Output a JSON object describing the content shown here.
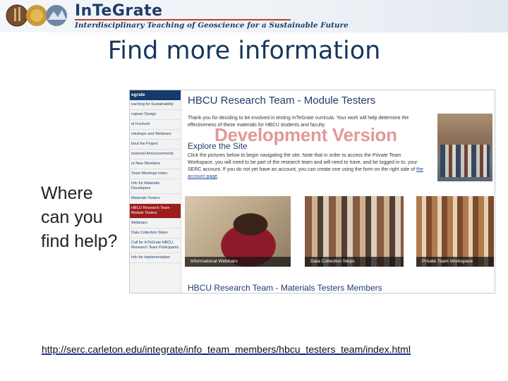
{
  "header": {
    "brand": "InTeGrate",
    "tagline": "Interdisciplinary Teaching of Geoscience for a Sustainable Future"
  },
  "slide": {
    "title": "Find more information",
    "question_lines": [
      "Where",
      "can you",
      "find help?"
    ],
    "url": "http://serc.carleton.edu/integrate/info_team_members/hbcu_testers_team/index.html"
  },
  "website": {
    "sidebar": {
      "header": "egrate",
      "items": [
        "eaching for Sustainability",
        "rogram Design",
        "et Involved",
        "orkshops and Webinars",
        "bout the Project",
        "essional Announcements",
        "or New Members",
        "Team Meetings Index",
        "Info for Materials Developers",
        "Materials Testers",
        "HBCU Research Team - Module Testers",
        "Webinars",
        "Data Collection Steps",
        "Call for InTeGrate HBCU Research Team Participants",
        "Info for Implementation"
      ],
      "active_index": 10
    },
    "title": "HBCU Research Team - Module Testers",
    "intro": "Thank you for deciding to be involved in testing InTeGrate curricula. Your work will help determine the effectiveness of these materials for HBCU students and faculty.",
    "watermark": "Development Version",
    "explore_heading": "Explore the Site",
    "explore_text": "Click the pictures below to begin navigating the site. Note that in order to access the Private Team Workspace, you will need to be part of the research team and will need to have, and be logged in to, your SERC account. If you do not yet have an account, you can create one using the form on the right side of",
    "explore_link": "the account page",
    "tiles": [
      {
        "caption": "Informational Webinars"
      },
      {
        "caption": "Data Collection Steps"
      },
      {
        "caption": "Private Team Workspace"
      }
    ],
    "bottom_heading": "HBCU Research Team - Materials Testers Members"
  }
}
